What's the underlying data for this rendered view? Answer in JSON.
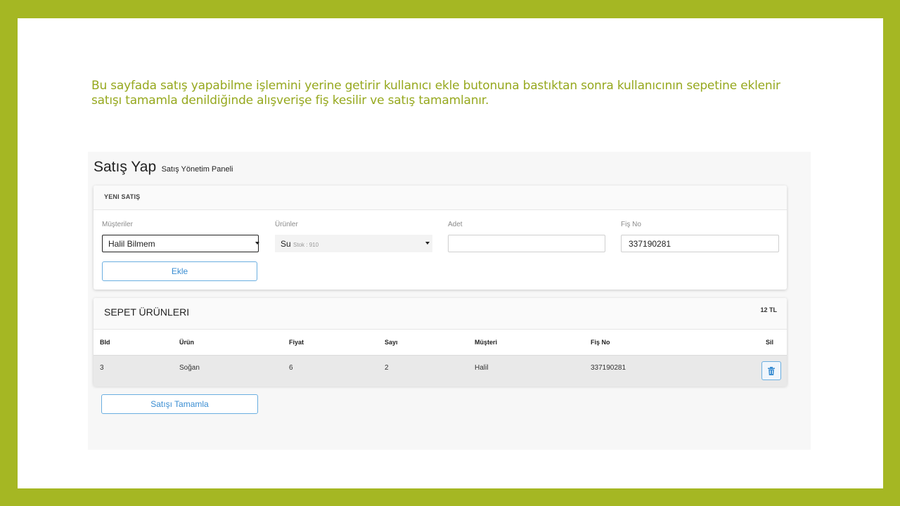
{
  "description": "Bu sayfada satış yapabilme işlemini yerine getirir kullanıcı ekle butonuna bastıktan sonra kullanıcının sepetine eklenir satışı tamamla denildiğinde alışverişe fiş kesilir ve satış tamamlanır.",
  "page": {
    "title": "Satış Yap",
    "subtitle": "Satış Yönetim Paneli"
  },
  "new_sale": {
    "header": "YENI SATIŞ",
    "customers_label": "Müşteriler",
    "customer_selected": "Halil Bilmem",
    "products_label": "Ürünler",
    "product_selected": "Su",
    "product_stock": "Stok : 910",
    "quantity_label": "Adet",
    "quantity_value": "",
    "receipt_label": "Fiş No",
    "receipt_value": "337190281",
    "add_button": "Ekle"
  },
  "cart": {
    "title": "SEPET ÜRÜNLERI",
    "total": "12 TL",
    "columns": [
      "BId",
      "Ürün",
      "Fiyat",
      "Sayı",
      "Müşteri",
      "Fiş No",
      "Sil"
    ],
    "rows": [
      {
        "id": "3",
        "product": "Soğan",
        "price": "6",
        "count": "2",
        "customer": "Halil",
        "receipt": "337190281"
      }
    ]
  },
  "complete_button": "Satışı Tamamla",
  "icons": {
    "delete": "trash-icon",
    "dropdown": "caret-down-icon"
  },
  "colors": {
    "frame": "#a5b723",
    "description_text": "#96a81e",
    "button_border": "#6aaee0",
    "button_text": "#3a8dd2"
  }
}
